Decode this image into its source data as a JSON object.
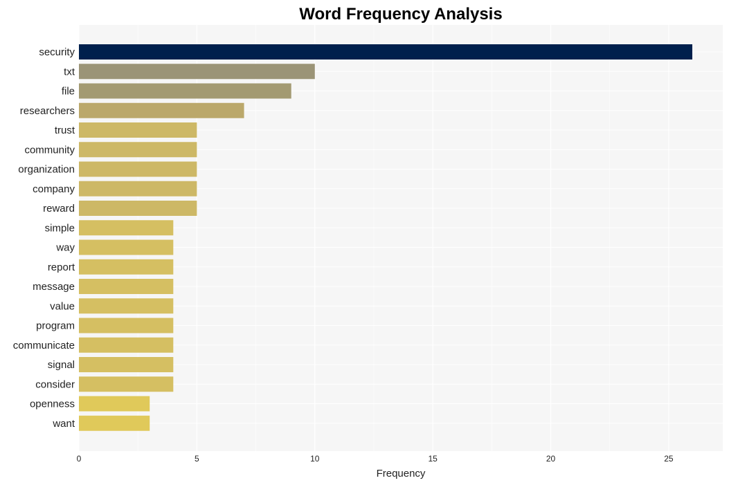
{
  "chart_data": {
    "type": "bar",
    "orientation": "horizontal",
    "title": "Word Frequency Analysis",
    "xlabel": "Frequency",
    "ylabel": "",
    "xlim": [
      0,
      27.3
    ],
    "xticks": [
      0,
      5,
      10,
      15,
      20,
      25
    ],
    "grid": true,
    "legend": "none",
    "categories": [
      "security",
      "txt",
      "file",
      "researchers",
      "trust",
      "community",
      "organization",
      "company",
      "reward",
      "simple",
      "way",
      "report",
      "message",
      "value",
      "program",
      "communicate",
      "signal",
      "consider",
      "openness",
      "want"
    ],
    "values": [
      26,
      10,
      9,
      7,
      5,
      5,
      5,
      5,
      5,
      4,
      4,
      4,
      4,
      4,
      4,
      4,
      4,
      4,
      3,
      3
    ],
    "colors": [
      "#00204d",
      "#9b9477",
      "#a39a72",
      "#bba86b",
      "#cdb866",
      "#cdb866",
      "#cdb866",
      "#cdb866",
      "#cdb866",
      "#d5bf62",
      "#d5bf62",
      "#d5bf62",
      "#d5bf62",
      "#d5bf62",
      "#d5bf62",
      "#d5bf62",
      "#d5bf62",
      "#d5bf62",
      "#e0c95a",
      "#e0c95a"
    ],
    "plot_background": "#f6f6f6",
    "grid_color": "#ffffff"
  }
}
